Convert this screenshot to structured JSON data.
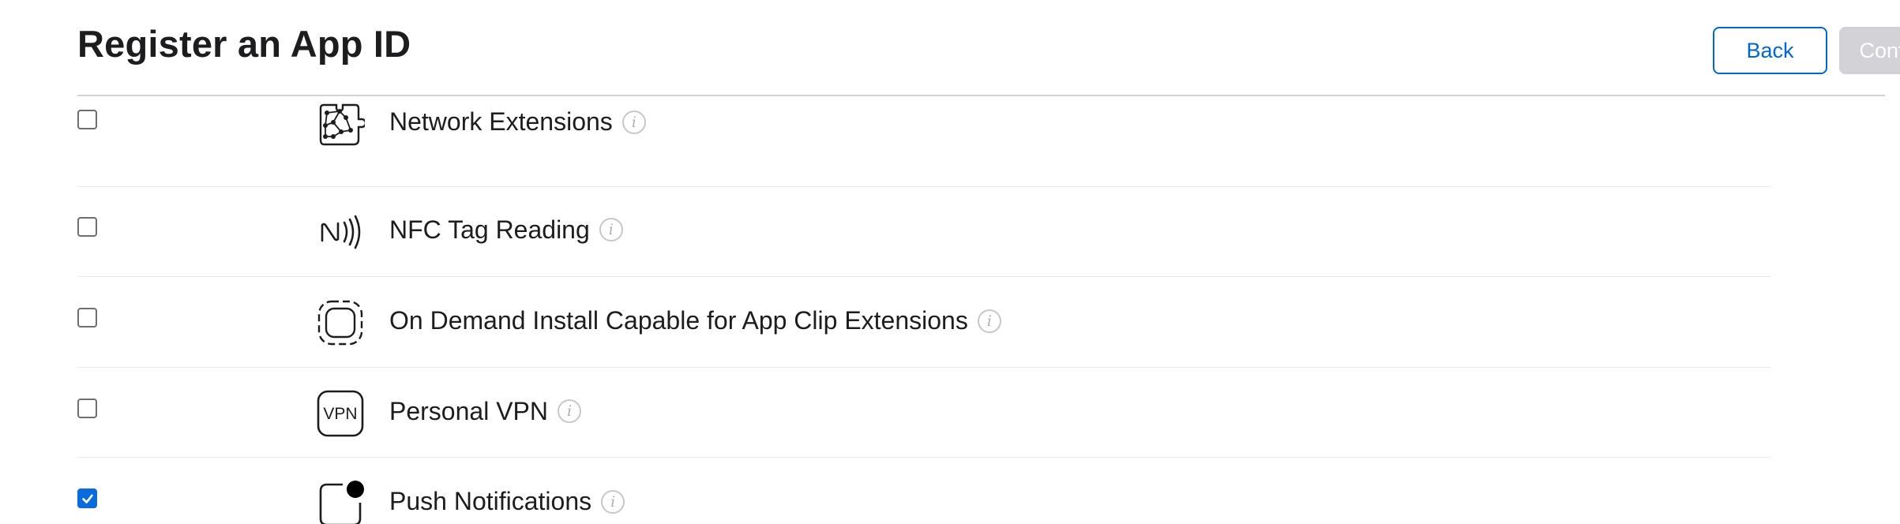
{
  "header": {
    "title": "Register an App ID",
    "back_label": "Back",
    "continue_label": "Continue"
  },
  "capabilities": [
    {
      "label": "Network Extensions",
      "checked": false,
      "icon": "network-extensions-icon"
    },
    {
      "label": "NFC Tag Reading",
      "checked": false,
      "icon": "nfc-icon"
    },
    {
      "label": "On Demand Install Capable for App Clip Extensions",
      "checked": false,
      "icon": "app-clip-icon"
    },
    {
      "label": "Personal VPN",
      "checked": false,
      "icon": "vpn-icon",
      "icon_text": "VPN"
    },
    {
      "label": "Push Notifications",
      "checked": true,
      "icon": "push-notifications-icon"
    }
  ],
  "colors": {
    "accent": "#0066cc",
    "checkbox_checked": "#0a6cdc",
    "disabled_button": "#d2d2d7",
    "divider": "#e8e8ed"
  }
}
